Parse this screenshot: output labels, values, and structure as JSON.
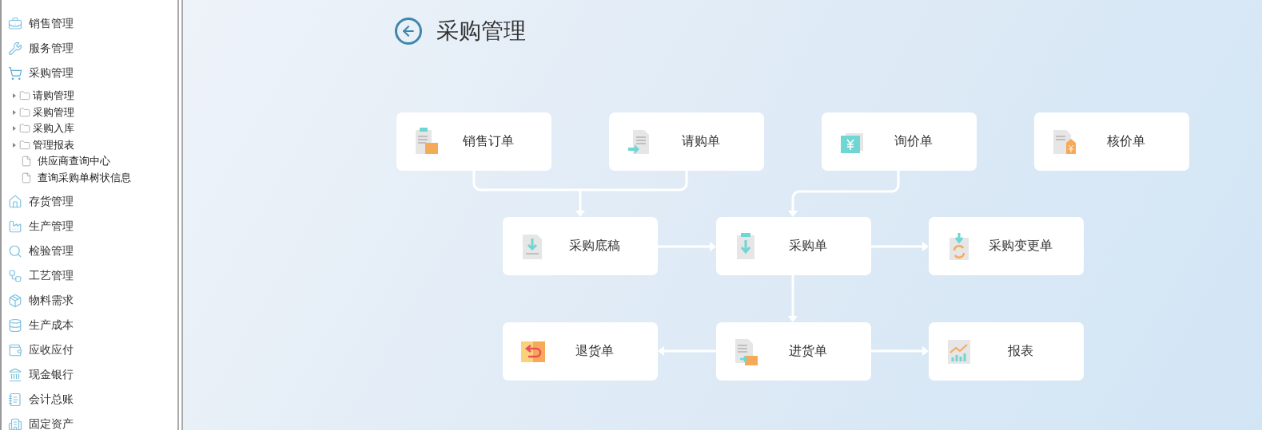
{
  "sidebar": {
    "items": [
      {
        "label": "销售管理",
        "expanded": false
      },
      {
        "label": "服务管理",
        "expanded": false
      },
      {
        "label": "采购管理",
        "expanded": true,
        "children": [
          {
            "kind": "folder",
            "label": "请购管理",
            "expanded": false
          },
          {
            "kind": "folder",
            "label": "采购管理",
            "expanded": false
          },
          {
            "kind": "folder",
            "label": "采购入库",
            "expanded": false
          },
          {
            "kind": "folder",
            "label": "管理报表",
            "expanded": false
          },
          {
            "kind": "file",
            "label": "供应商查询中心"
          },
          {
            "kind": "file",
            "label": "查询采购单树状信息"
          }
        ]
      },
      {
        "label": "存货管理",
        "expanded": false
      },
      {
        "label": "生产管理",
        "expanded": false
      },
      {
        "label": "检验管理",
        "expanded": false
      },
      {
        "label": "工艺管理",
        "expanded": false
      },
      {
        "label": "物料需求",
        "expanded": false
      },
      {
        "label": "生产成本",
        "expanded": false
      },
      {
        "label": "应收应付",
        "expanded": false
      },
      {
        "label": "现金银行",
        "expanded": false
      },
      {
        "label": "会计总账",
        "expanded": false
      },
      {
        "label": "固定资产",
        "expanded": false
      }
    ]
  },
  "page": {
    "title": "采购管理"
  },
  "flow": {
    "nodes": [
      {
        "label": "销售订单"
      },
      {
        "label": "请购单"
      },
      {
        "label": "询价单"
      },
      {
        "label": "核价单"
      },
      {
        "label": "采购底稿"
      },
      {
        "label": "采购单"
      },
      {
        "label": "采购变更单"
      },
      {
        "label": "退货单"
      },
      {
        "label": "进货单"
      },
      {
        "label": "报表"
      }
    ]
  }
}
